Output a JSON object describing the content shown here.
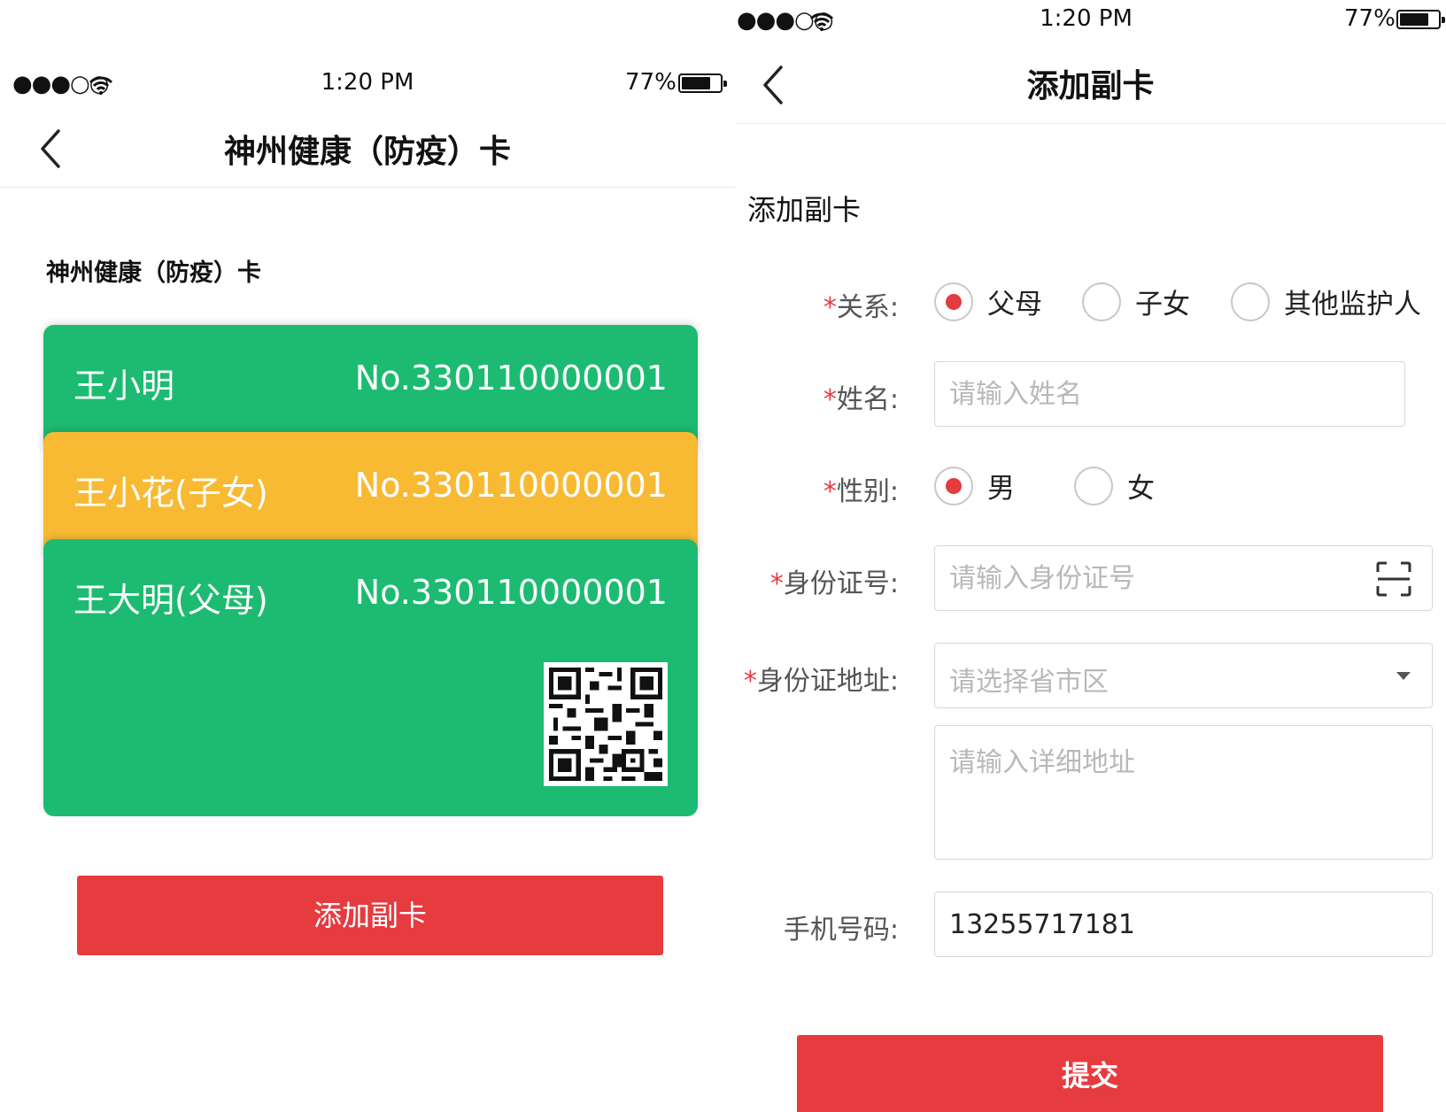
{
  "status": {
    "signal": "●●●○○",
    "time": "1:20 PM",
    "battery": "77%"
  },
  "colors": {
    "green": "#1cbb71",
    "orange": "#f8ba33",
    "red": "#e63b3f"
  },
  "left": {
    "title": "神州健康（防疫）卡",
    "section_heading": "神州健康（防疫）卡",
    "cards": [
      {
        "name": "王小明",
        "number": "No.330110000001",
        "color": "#1cbb71"
      },
      {
        "name": "王小花(子女)",
        "number": "No.330110000001",
        "color": "#f8ba33"
      },
      {
        "name": "王大明(父母)",
        "number": "No.330110000001",
        "color": "#1cbb71"
      }
    ],
    "add_button": "添加副卡"
  },
  "right": {
    "title": "添加副卡",
    "form_heading": "添加副卡",
    "relation": {
      "label": "关系:",
      "options": [
        {
          "label": "父母",
          "selected": true
        },
        {
          "label": "子女",
          "selected": false
        },
        {
          "label": "其他监护人",
          "selected": false
        }
      ]
    },
    "name": {
      "label": "姓名:",
      "placeholder": "请输入姓名"
    },
    "gender": {
      "label": "性别:",
      "options": [
        {
          "label": "男",
          "selected": true
        },
        {
          "label": "女",
          "selected": false
        }
      ]
    },
    "id_number": {
      "label": "身份证号:",
      "placeholder": "请输入身份证号"
    },
    "id_address": {
      "label": "身份证地址:",
      "select_placeholder": "请选择省市区",
      "detail_placeholder": "请输入详细地址"
    },
    "phone": {
      "label": "手机号码:",
      "value": "13255717181"
    },
    "submit": "提交"
  }
}
